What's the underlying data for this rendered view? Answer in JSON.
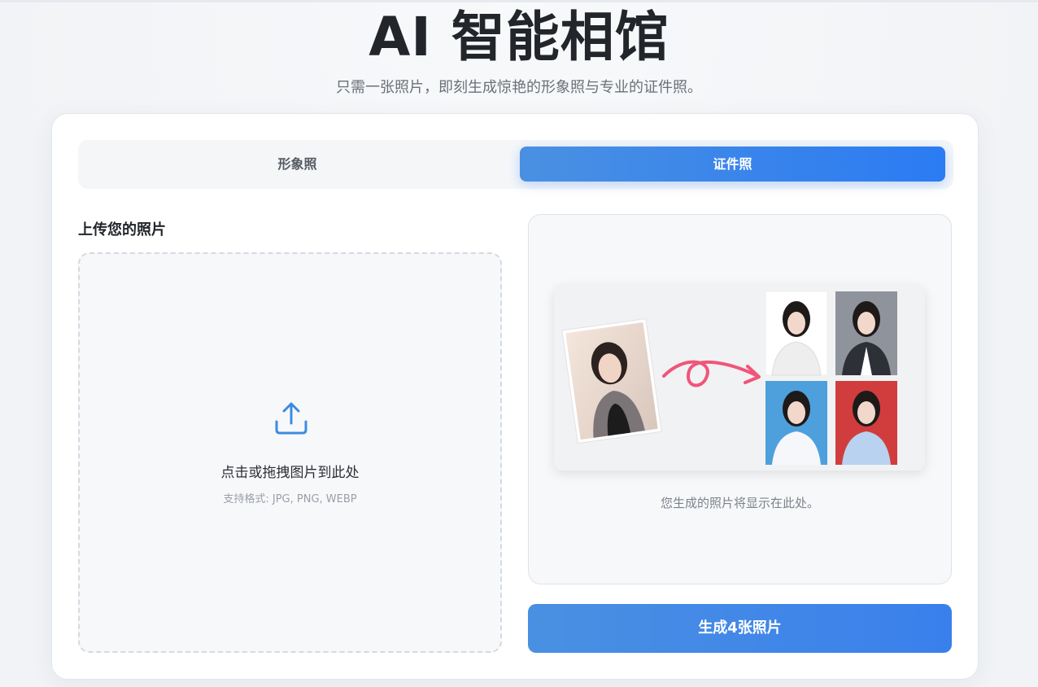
{
  "header": {
    "title": "AI 智能相馆",
    "subtitle": "只需一张照片，即刻生成惊艳的形象照与专业的证件照。"
  },
  "tabs": [
    {
      "label": "形象照",
      "active": false
    },
    {
      "label": "证件照",
      "active": true
    }
  ],
  "upload": {
    "section_label": "上传您的照片",
    "prompt": "点击或拖拽图片到此处",
    "formats": "支持格式: JPG, PNG, WEBP",
    "icon": "upload-icon"
  },
  "preview": {
    "placeholder": "您生成的照片将显示在此处。",
    "sample_backgrounds": [
      "#ffffff",
      "#8f939b",
      "#4da0dc",
      "#d13d3d"
    ]
  },
  "actions": {
    "generate_label": "生成4张照片"
  },
  "colors": {
    "accent": "#2b7bf3",
    "accent_light": "#4a90e2"
  }
}
